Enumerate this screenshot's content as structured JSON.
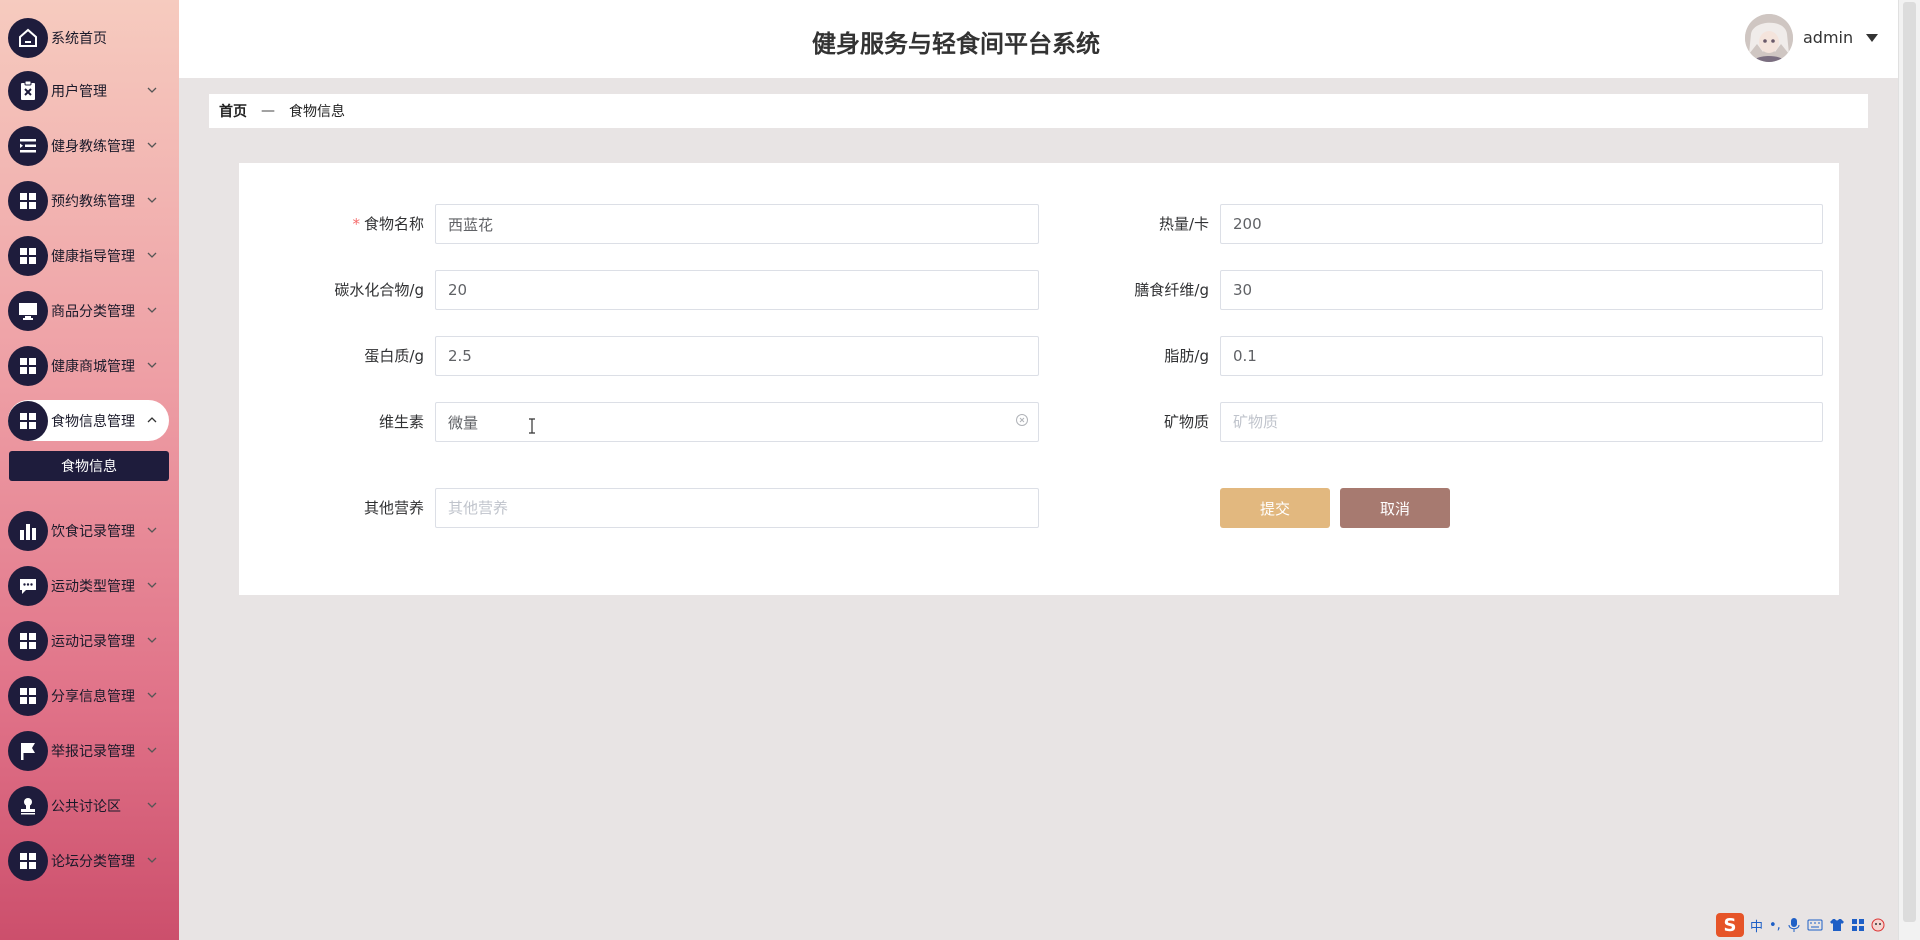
{
  "app": {
    "title": "健身服务与轻食间平台系统",
    "username": "admin"
  },
  "sidebar": {
    "items": [
      {
        "label": "系统首页",
        "icon": "home-icon",
        "has_children": false
      },
      {
        "label": "用户管理",
        "icon": "clipboard-x-icon",
        "has_children": true
      },
      {
        "label": "健身教练管理",
        "icon": "list-indent-icon",
        "has_children": true
      },
      {
        "label": "预约教练管理",
        "icon": "grid-icon",
        "has_children": true
      },
      {
        "label": "健康指导管理",
        "icon": "grid-icon",
        "has_children": true
      },
      {
        "label": "商品分类管理",
        "icon": "monitor-icon",
        "has_children": true
      },
      {
        "label": "健康商城管理",
        "icon": "grid-icon",
        "has_children": true
      },
      {
        "label": "食物信息管理",
        "icon": "grid-icon",
        "has_children": true,
        "expanded": true
      },
      {
        "label": "饮食记录管理",
        "icon": "bar-chart-icon",
        "has_children": true
      },
      {
        "label": "运动类型管理",
        "icon": "chat-bubble-icon",
        "has_children": true
      },
      {
        "label": "运动记录管理",
        "icon": "grid-icon",
        "has_children": true
      },
      {
        "label": "分享信息管理",
        "icon": "grid-icon",
        "has_children": true
      },
      {
        "label": "举报记录管理",
        "icon": "flag-icon",
        "has_children": true
      },
      {
        "label": "公共讨论区",
        "icon": "stamp-icon",
        "has_children": true
      },
      {
        "label": "论坛分类管理",
        "icon": "grid-icon",
        "has_children": true
      }
    ],
    "submenu": {
      "label": "食物信息"
    }
  },
  "breadcrumb": {
    "home": "首页",
    "separator": "—",
    "current": "食物信息"
  },
  "form": {
    "food_name": {
      "label": "食物名称",
      "required": true,
      "value": "西蓝花",
      "placeholder": "食物名称"
    },
    "calories": {
      "label": "热量/卡",
      "value": "200",
      "placeholder": "热量/卡"
    },
    "carbs": {
      "label": "碳水化合物/g",
      "value": "20",
      "placeholder": "碳水化合物/g"
    },
    "fiber": {
      "label": "膳食纤维/g",
      "value": "30",
      "placeholder": "膳食纤维/g"
    },
    "protein": {
      "label": "蛋白质/g",
      "value": "2.5",
      "placeholder": "蛋白质/g"
    },
    "fat": {
      "label": "脂肪/g",
      "value": "0.1",
      "placeholder": "脂肪/g"
    },
    "vitamins": {
      "label": "维生素",
      "value": "微量",
      "placeholder": "维生素"
    },
    "minerals": {
      "label": "矿物质",
      "value": "",
      "placeholder": "矿物质"
    },
    "other": {
      "label": "其他营养",
      "value": "",
      "placeholder": "其他营养"
    },
    "submit_label": "提交",
    "cancel_label": "取消"
  },
  "tray": {
    "ime_logo": "S",
    "ime_lang": "中",
    "ime_punct": "•,"
  },
  "colors": {
    "sidebar_icon_bg": "#1e1c3c",
    "submit": "#e2b87f",
    "cancel": "#a77a70",
    "required": "#f56c6c"
  }
}
